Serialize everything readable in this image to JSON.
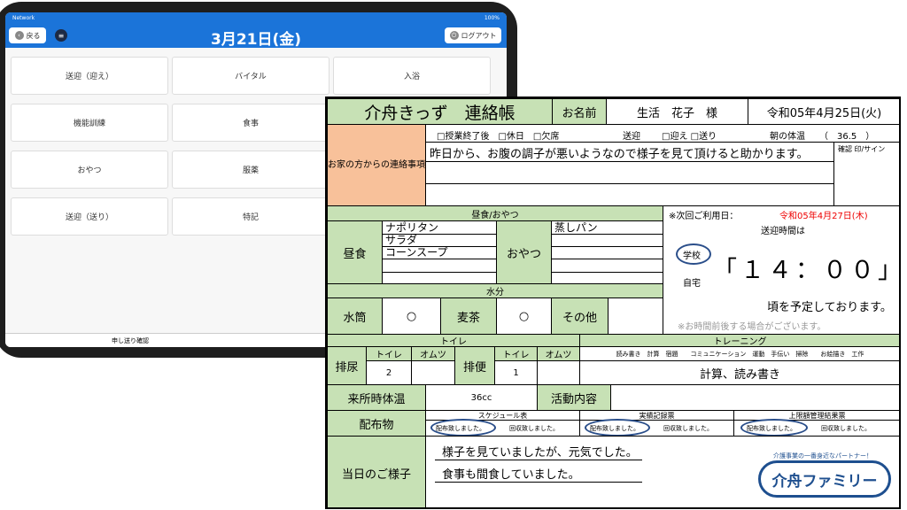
{
  "tablet": {
    "status_network": "Network",
    "status_battery": "100%",
    "back_label": "戻る",
    "menu_icon": "list-icon",
    "date_title": "3月21日(金)",
    "logout_label": "ログアウト",
    "buttons": [
      "送迎（迎え）",
      "バイタル",
      "入浴",
      "機能訓練",
      "食事",
      "おやつ",
      "服薬",
      "送迎（送り）",
      "特記"
    ],
    "bottom_label": "申し送り確認"
  },
  "form": {
    "title": "介舟きっず　連絡帳",
    "name_label": "お名前",
    "name_value": "生活　花子　様",
    "date_value": "令和05年4月25日(火)",
    "family_label": "お家の方からの連絡事項",
    "attendance_options": "□授業終了後　□休日　□欠席",
    "pickup_label": "送迎",
    "pickup_options": "□迎え □送り",
    "morning_temp_label": "朝の体温",
    "morning_temp_value": "（　36.5　）",
    "family_message": "昨日から、お腹の調子が悪いようなので様子を見て頂けると助かります。",
    "confirm_label": "確認 印/サイン",
    "meal_header": "昼食/おやつ",
    "lunch_label": "昼食",
    "lunch_items": [
      "ナポリタン",
      "サラダ",
      "コーンスープ",
      ""
    ],
    "snack_label": "おやつ",
    "snack_items": [
      "蒸しパン",
      "",
      "",
      ""
    ],
    "next_use_label": "※次回ご利用日：",
    "next_use_date": "令和05年4月27日(木)",
    "pickup_time_label": "送迎時間は",
    "school_label": "学校",
    "home_label": "自宅",
    "pickup_time": "「１４：００」",
    "schedule_text": "頃を予定しております。",
    "note_text": "※お時間前後する場合がございます。",
    "water_header": "水分",
    "water_bottle_label": "水筒",
    "water_bottle_value": "○",
    "barley_tea_label": "麦茶",
    "barley_tea_value": "○",
    "other_label": "その他",
    "toilet_header": "トイレ",
    "urination_label": "排尿",
    "defecation_label": "排便",
    "toilet_col": "トイレ",
    "diaper_col": "オムツ",
    "urination_toilet": "2",
    "defecation_toilet": "1",
    "training_header": "トレーニング",
    "training_options": "読み書き　計算　宿題　　コミュニケーション　運動　手伝い　掃除　　お絵描き　工作",
    "training_value": "計算、読み書き",
    "arrival_temp_label": "来所時体温",
    "arrival_temp_value": "36cc",
    "activity_label": "活動内容",
    "distribution_label": "配布物",
    "dist_columns": [
      "スケジュール表",
      "実績記録票",
      "上限額管理結果票"
    ],
    "distributed": "配布致しました。",
    "collected": "回収致しました。",
    "today_label": "当日のご様子",
    "today_lines": [
      "様子を見ていましたが、元気でした。",
      "食事も間食していました。"
    ],
    "logo_tagline": "介護事業の一番身近なパートナー！",
    "logo_text": "介舟ファミリー"
  }
}
